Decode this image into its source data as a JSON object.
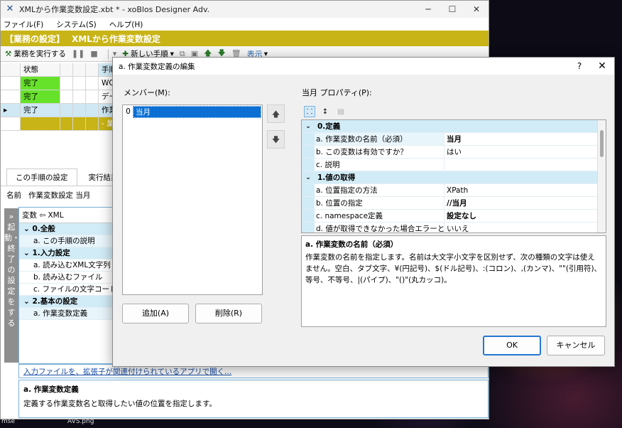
{
  "window": {
    "title": "XMLから作業変数設定.xbt * - xoBlos Designer Adv.",
    "minimize": "─",
    "maximize": "☐",
    "close": "✕"
  },
  "menu": [
    "ファイル(F)",
    "システム(S)",
    "ヘルプ(H)"
  ],
  "banner": {
    "bracket": "【業務の設定】",
    "title": "XMLから作業変数設定"
  },
  "toolbar": {
    "run_label": "業務を実行する",
    "new_step_label": "新しい手順",
    "view_label": "表示"
  },
  "grid": {
    "header": [
      "状態",
      "手順"
    ],
    "rows": [
      {
        "status": "完了",
        "text": "WO"
      },
      {
        "status": "完了",
        "text": "デー"
      },
      {
        "status": "完了",
        "text": "作業"
      },
      {
        "status": "",
        "text": "- 業"
      }
    ]
  },
  "lower": {
    "tabs": [
      "この手順の設定",
      "実行結果"
    ],
    "name_label": "名前",
    "name_value": "作業変数設定 当月",
    "side_text": "» 起動・終了の設定をする",
    "panel_header": "変数 ⇦ XML",
    "props": [
      {
        "type": "cat",
        "label": "0.全般"
      },
      {
        "type": "sub",
        "label": "a. この手順の説明"
      },
      {
        "type": "cat",
        "label": "1.入力設定"
      },
      {
        "type": "item",
        "label": "a. 読み込むXML文字列"
      },
      {
        "type": "item",
        "label": "b. 読み込むファイル"
      },
      {
        "type": "item",
        "label": "c. ファイルの文字コード"
      },
      {
        "type": "cat",
        "label": "2.基本の設定"
      },
      {
        "type": "sub",
        "label": "a. 作業変数定義"
      }
    ],
    "link_text": "入力ファイルを、拡張子が関連付けられているアプリで開く...",
    "desc_title": "a. 作業変数定義",
    "desc_text": "定義する作業変数名と取得したい値の位置を指定します。"
  },
  "dialog": {
    "title": "a. 作業変数定義の編集",
    "help": "?",
    "close": "✕",
    "members_label": "メンバー(M):",
    "members": [
      {
        "index": "0",
        "name": "当月"
      }
    ],
    "up": "🡅",
    "down": "🡇",
    "add": "追加(A)",
    "delete": "削除(R)",
    "props_label": "当月 プロパティ(P):",
    "prop_rows": [
      {
        "type": "cat",
        "label": "0.定義"
      },
      {
        "type": "item",
        "key": "a. 作業変数の名前（必須）",
        "value": "当月",
        "bold": true
      },
      {
        "type": "item",
        "key": "b. この変数は有効ですか？",
        "value": "はい",
        "bold": false
      },
      {
        "type": "item",
        "key": "c. 説明",
        "value": "",
        "bold": false
      },
      {
        "type": "cat",
        "label": "1.値の取得"
      },
      {
        "type": "item",
        "key": "a. 位置指定の方法",
        "value": "XPath",
        "bold": false
      },
      {
        "type": "item",
        "key": "b. 位置の指定",
        "value": "//当月",
        "bold": true
      },
      {
        "type": "item",
        "key": "c. namespace定義",
        "value": "設定なし",
        "bold": true
      },
      {
        "type": "item",
        "key": "d. 値が取得できなかった場合エラーと",
        "value": "いいえ",
        "bold": false
      }
    ],
    "desc_title": "a. 作業変数の名前（必須）",
    "desc_text": "作業変数の名前を指定します。名前は大文字小文字を区別せず、次の種類の文字は使えません。空白、タブ文字、¥(円記号)、$(ドル記号)、:(コロン)、,(カンマ)、\"\"(引用符)、等号、不等号、|(パイプ)、\"()\"(丸カッコ)。",
    "ok": "OK",
    "cancel": "キャンセル"
  },
  "desktop": {
    "labels": [
      "mse",
      "AVS.png"
    ]
  }
}
